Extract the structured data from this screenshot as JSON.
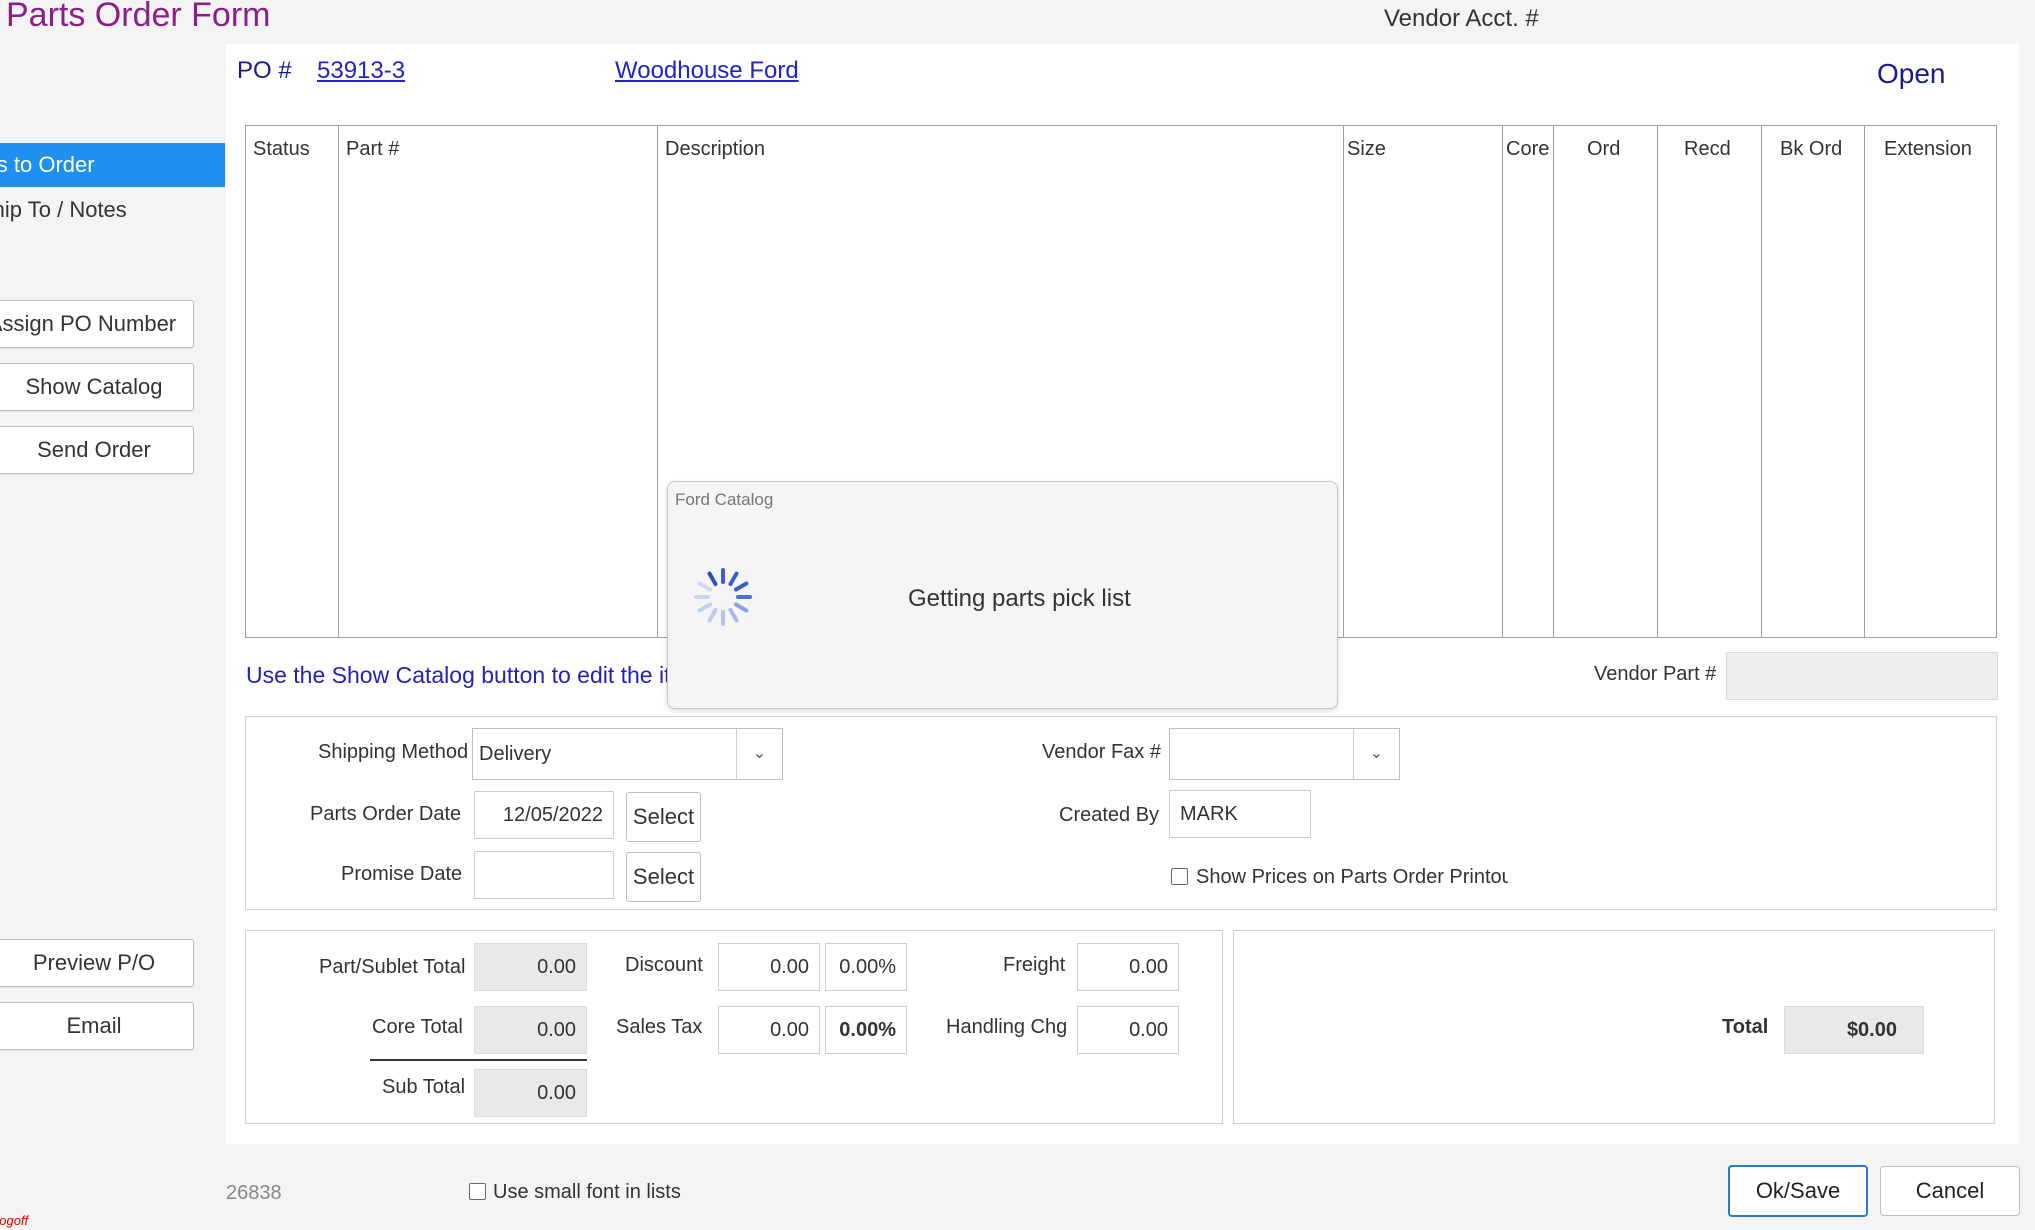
{
  "header": {
    "title": "Parts Order Form",
    "vendor_acct_label": "Vendor Acct. #",
    "po_label": "PO #",
    "po_number": "53913-3",
    "vendor_name": "Woodhouse Ford",
    "status": "Open"
  },
  "sidebar": {
    "tabs": [
      {
        "label": "Items to Order",
        "active": true
      },
      {
        "label": "Ship To / Notes",
        "active": false
      }
    ],
    "buttons": {
      "assign_po": "Assign PO Number",
      "show_catalog": "Show Catalog",
      "send_order": "Send Order",
      "preview": "Preview P/O",
      "email": "Email"
    },
    "logoff": "Logoff"
  },
  "grid": {
    "columns": [
      "Status",
      "Part #",
      "Description",
      "Size",
      "Core",
      "Ord",
      "Recd",
      "Bk Ord",
      "Extension"
    ]
  },
  "hint": "Use the Show Catalog button to edit the items",
  "vendor_part_label": "Vendor Part #",
  "shipping": {
    "method_label": "Shipping Method",
    "method_value": "Delivery",
    "order_date_label": "Parts Order Date",
    "order_date_value": "12/05/2022",
    "promise_date_label": "Promise Date",
    "promise_date_value": "",
    "select_label": "Select",
    "vendor_fax_label": "Vendor Fax #",
    "vendor_fax_value": "",
    "created_by_label": "Created By",
    "created_by_value": "MARK",
    "show_prices_label": "Show Prices on Parts Order Printout"
  },
  "totals": {
    "part_sublet_label": "Part/Sublet Total",
    "part_sublet_value": "0.00",
    "core_total_label": "Core Total",
    "core_total_value": "0.00",
    "sub_total_label": "Sub Total",
    "sub_total_value": "0.00",
    "discount_label": "Discount",
    "discount_value": "0.00",
    "discount_pct": "0.00%",
    "sales_tax_label": "Sales Tax",
    "sales_tax_value": "0.00",
    "sales_tax_pct": "0.00%",
    "freight_label": "Freight",
    "freight_value": "0.00",
    "handling_label": "Handling Chg",
    "handling_value": "0.00",
    "total_label": "Total",
    "total_value": "$0.00"
  },
  "modal": {
    "title": "Ford Catalog",
    "message": "Getting parts pick list"
  },
  "footer": {
    "record_number": "26838",
    "small_font_label": "Use small font in lists",
    "ok_label": "Ok/Save",
    "cancel_label": "Cancel"
  },
  "colors": {
    "title": "#8a1e8a",
    "active_tab": "#1e90f0",
    "link": "#2222cc",
    "status": "#1a1a8c"
  },
  "icons": [
    "chevron-down-icon",
    "spinner-icon",
    "checkbox-icon"
  ]
}
